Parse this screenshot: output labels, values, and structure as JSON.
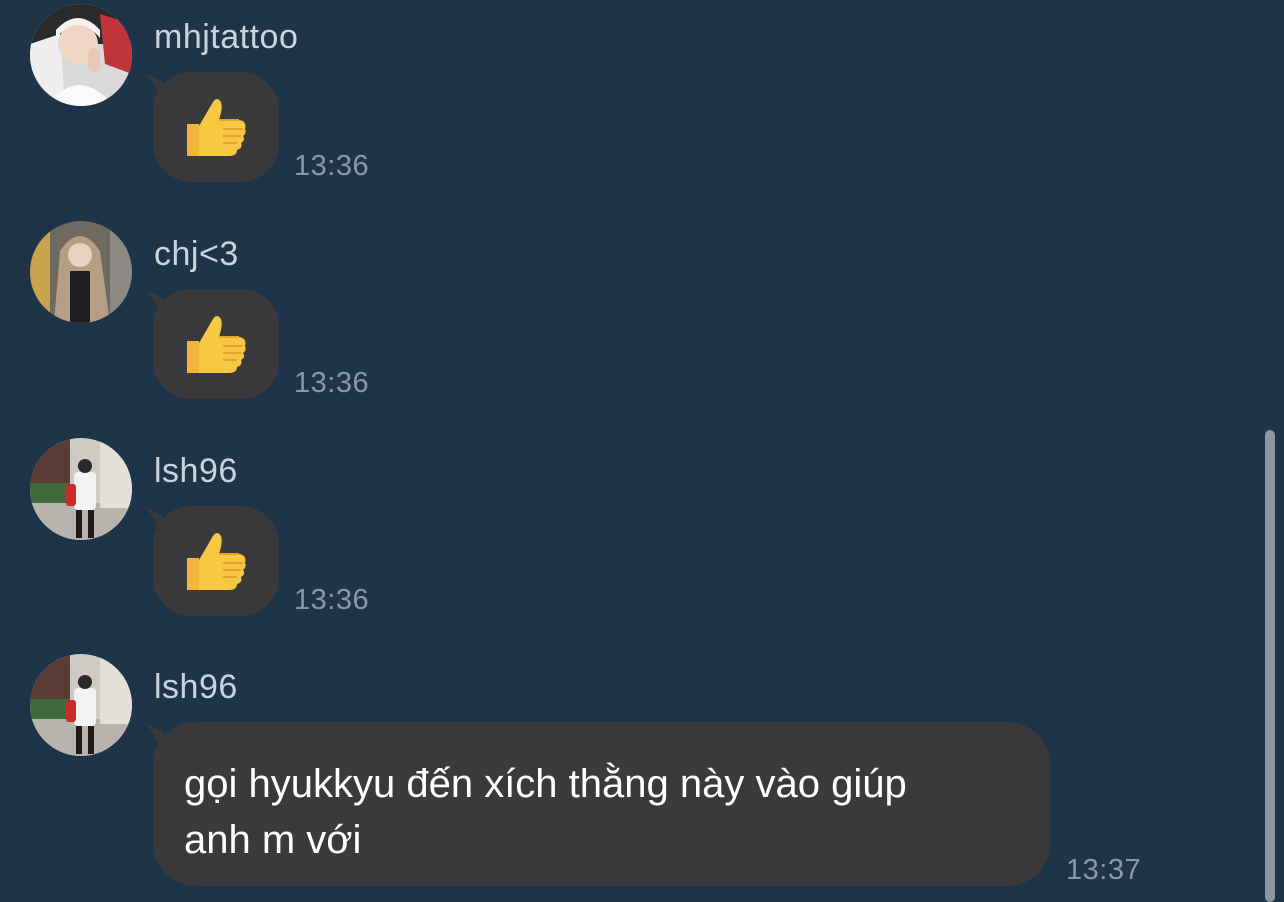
{
  "chat": {
    "messages": [
      {
        "sender": "mhjtattoo",
        "kind": "emoji",
        "content": "👍",
        "time": "13:36",
        "avatar": "avatar-mhjtattoo"
      },
      {
        "sender": "chj<3",
        "kind": "emoji",
        "content": "👍",
        "time": "13:36",
        "avatar": "avatar-chj"
      },
      {
        "sender": "lsh96",
        "kind": "emoji",
        "content": "👍",
        "time": "13:36",
        "avatar": "avatar-lsh96"
      },
      {
        "sender": "lsh96",
        "kind": "text",
        "content": "gọi hyukkyu đến xích thằng này vào giúp\nanh m với",
        "time": "13:37",
        "avatar": "avatar-lsh96"
      }
    ]
  },
  "colors": {
    "background": "#1e3448",
    "bubble": "#3a3a3c",
    "sender_text": "#c9d3dc",
    "time_text": "#8a98a6",
    "message_text": "#ffffff",
    "thumbs_up": "#f7c942"
  },
  "icons": {
    "thumbs_up": "thumbs-up-icon"
  }
}
